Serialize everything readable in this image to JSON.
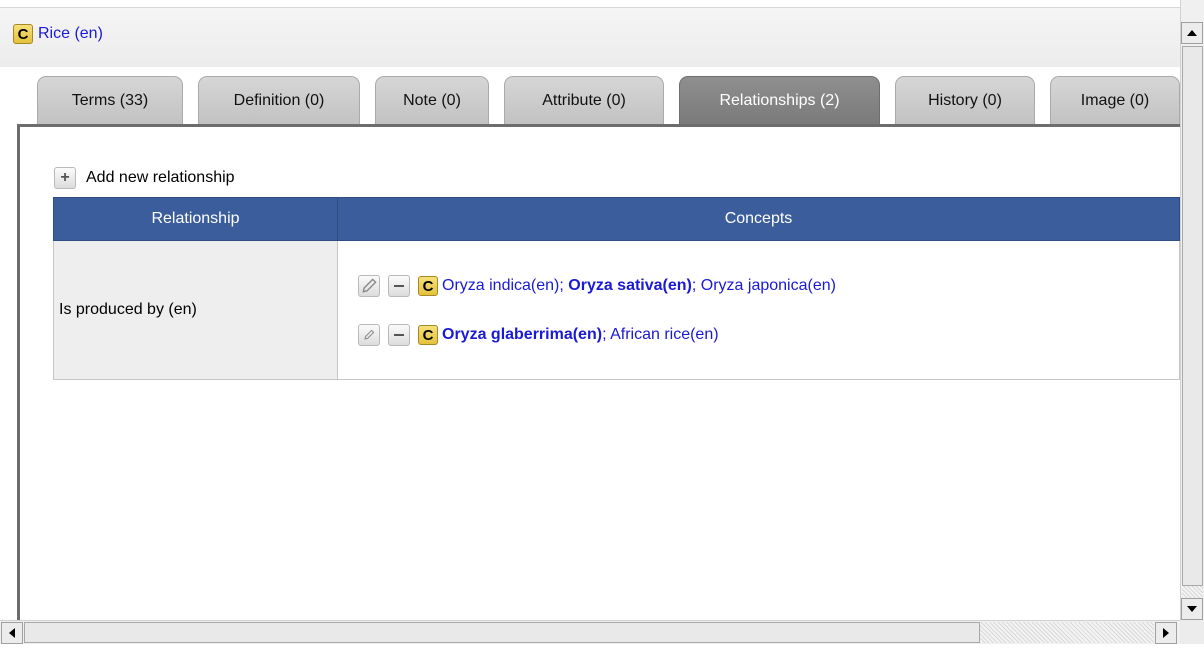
{
  "concept": {
    "badge": "C",
    "title": "Rice (en)"
  },
  "tabs": [
    {
      "label": "Terms (33)",
      "active": false
    },
    {
      "label": "Definition (0)",
      "active": false
    },
    {
      "label": "Note (0)",
      "active": false
    },
    {
      "label": "Attribute  (0)",
      "active": false
    },
    {
      "label": "Relationships (2)",
      "active": true
    },
    {
      "label": "History (0)",
      "active": false
    },
    {
      "label": "Image (0)",
      "active": false
    }
  ],
  "add_relationship": {
    "icon": "plus-icon",
    "label": "Add new relationship"
  },
  "table": {
    "headers": {
      "relationship": "Relationship",
      "concepts": "Concepts"
    },
    "rows": [
      {
        "relationship": "Is produced by (en)",
        "concepts": [
          {
            "badge": "C",
            "sep1": "; ",
            "sep2": "; ",
            "t1": "Oryza indica(en)",
            "t2": "Oryza sativa(en)",
            "t3": "Oryza japonica(en)"
          },
          {
            "badge": "C",
            "sep1": "; ",
            "t1": "Oryza glaberrima(en)",
            "t2": "African rice(en)"
          }
        ]
      }
    ]
  },
  "icons": {
    "edit": "pencil-icon",
    "remove": "minus-icon",
    "concept": "concept-badge-icon",
    "scroll_up": "arrow-up-icon",
    "scroll_down": "arrow-down-icon",
    "scroll_left": "arrow-left-icon",
    "scroll_right": "arrow-right-icon"
  },
  "colors": {
    "header_blue": "#3b5d9c",
    "link_blue": "#1a1ad6",
    "active_tab": "#7a7a7a",
    "inactive_tab": "#c8c8c8",
    "badge_yellow": "#eccf52"
  }
}
